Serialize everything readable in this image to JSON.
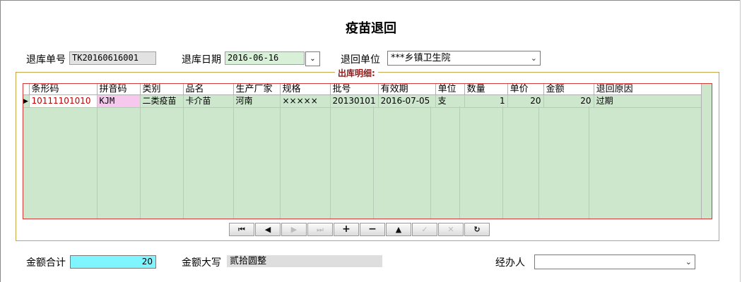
{
  "title": "疫苗退回",
  "header": {
    "return_no_label": "退库单号",
    "return_no_value": "TK20160616001",
    "return_date_label": "退库日期",
    "return_date_value": "2016-06-16",
    "return_unit_label": "退回单位",
    "return_unit_value": "***乡镇卫生院"
  },
  "detail": {
    "group_title": "出库明细:",
    "columns": [
      "条形码",
      "拼音码",
      "类别",
      "品名",
      "生产厂家",
      "规格",
      "批号",
      "有效期",
      "单位",
      "数量",
      "单价",
      "金额",
      "退回原因"
    ],
    "rows": [
      [
        "10111101010",
        "KJM",
        "二类疫苗",
        "卡介苗",
        "河南",
        "×××××",
        "20130101",
        "2016-07-05",
        "支",
        "1",
        "20",
        "20",
        "过期"
      ]
    ]
  },
  "navigator": {
    "buttons": [
      {
        "name": "first-record-button",
        "glyph": "⏮",
        "enabled": true
      },
      {
        "name": "prior-record-button",
        "glyph": "◀",
        "enabled": true
      },
      {
        "name": "next-record-button",
        "glyph": "▶",
        "enabled": false
      },
      {
        "name": "last-record-button",
        "glyph": "⏭",
        "enabled": false
      },
      {
        "name": "insert-record-button",
        "glyph": "+",
        "enabled": true
      },
      {
        "name": "delete-record-button",
        "glyph": "−",
        "enabled": true
      },
      {
        "name": "edit-record-button",
        "glyph": "▲",
        "enabled": true
      },
      {
        "name": "post-record-button",
        "glyph": "✓",
        "enabled": false
      },
      {
        "name": "cancel-record-button",
        "glyph": "✕",
        "enabled": false
      },
      {
        "name": "refresh-record-button",
        "glyph": "↻",
        "enabled": true
      }
    ]
  },
  "footer": {
    "total_label": "金额合计",
    "total_value": "20",
    "capital_label": "金额大写",
    "capital_value": "贰拾圆整",
    "handler_label": "经办人",
    "handler_value": ""
  },
  "colors": {
    "grid_bg": "#cde7cd",
    "total_bg": "#7ff5ff",
    "date_bg": "#d8f0d8",
    "pinyin_bg": "#f6c8ee",
    "group_title": "#8b1a1a"
  }
}
